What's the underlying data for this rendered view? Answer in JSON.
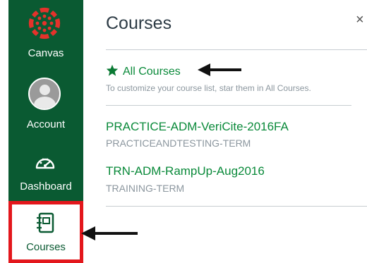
{
  "nav": {
    "canvas_label": "Canvas",
    "account_label": "Account",
    "dashboard_label": "Dashboard",
    "courses_label": "Courses"
  },
  "tray": {
    "title": "Courses",
    "close_symbol": "×",
    "all_courses_label": "All Courses",
    "hint": "To customize your course list, star them in All Courses.",
    "courses": [
      {
        "name": "PRACTICE-ADM-VeriCite-2016FA",
        "term": "PRACTICEANDTESTING-TERM"
      },
      {
        "name": "TRN-ADM-RampUp-Aug2016",
        "term": "TRAINING-TERM"
      }
    ]
  },
  "colors": {
    "nav_background": "#0a5a32",
    "link": "#0a8a3a",
    "logo": "#e4322b",
    "highlight_box": "#e3171c"
  },
  "icons": [
    "canvas-logo-icon",
    "avatar-icon",
    "dashboard-gauge-icon",
    "notebook-icon",
    "star-icon",
    "close-icon",
    "arrow-left-icon"
  ]
}
